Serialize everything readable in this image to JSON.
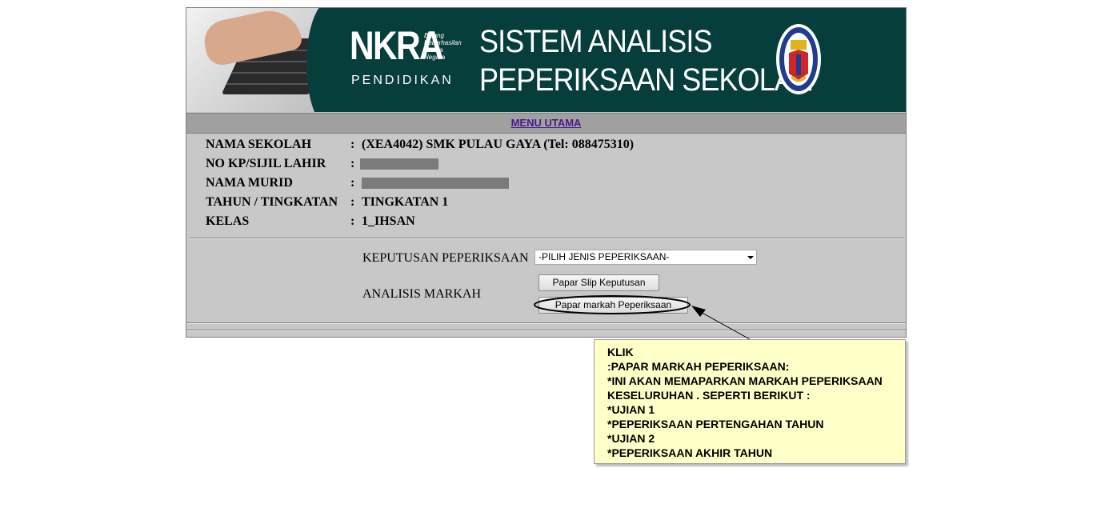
{
  "banner": {
    "logo_main": "NKRA",
    "logo_sub": [
      "Bidang",
      "Keberhasilan",
      "Utama",
      "Negara"
    ],
    "logo_caption": "PENDIDIKAN",
    "title_line1": "SISTEM ANALISIS",
    "title_line2": "PEPERIKSAAN SEKOLAH",
    "crest_icon": "ministry-crest-icon",
    "photo_icon": "keyboard-hand-photo"
  },
  "menu": {
    "label": "MENU UTAMA"
  },
  "info": [
    {
      "label": "NAMA SEKOLAH",
      "value": "(XEA4042) SMK PULAU GAYA (Tel: 088475310)"
    },
    {
      "label": "NO KP/SIJIL LAHIR",
      "value": ""
    },
    {
      "label": "NAMA MURID",
      "value": ""
    },
    {
      "label": "TAHUN / TINGKATAN",
      "value": "TINGKATAN 1"
    },
    {
      "label": "KELAS",
      "value": "1_IHSAN"
    }
  ],
  "colon": ":",
  "exam": {
    "label": "KEPUTUSAN PEPERIKSAAN",
    "selected": "-PILIH JENIS PEPERIKSAAN-"
  },
  "analysis": {
    "label": "ANALISIS MARKAH",
    "btn_slip": "Papar Slip Keputusan",
    "btn_markah": "Papar markah Peperiksaan"
  },
  "callout": {
    "lines": [
      "KLIK",
      ":PAPAR MARKAH PEPERIKSAAN:",
      "*INI AKAN MEMAPARKAN MARKAH PEPERIKSAAN",
      "KESELURUHAN . SEPERTI BERIKUT :",
      "*UJIAN 1",
      "*PEPERIKSAAN PERTENGAHAN TAHUN",
      "*UJIAN 2",
      "*PEPERIKSAAN AKHIR TAHUN"
    ]
  },
  "colors": {
    "banner_bg": "#063e3c",
    "panel_bg": "#c8c8c8",
    "menu_link": "#4b1a8c",
    "callout_bg": "#ffffc8"
  }
}
